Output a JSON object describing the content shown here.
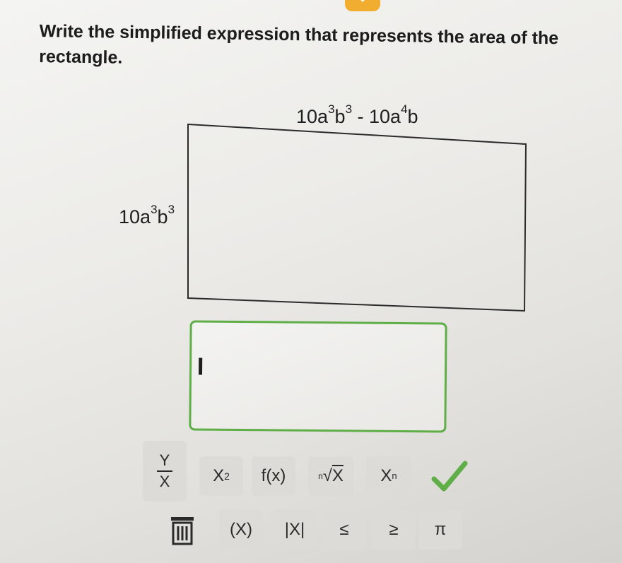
{
  "question": {
    "line1": "Write the simplified expression that represents the area of the",
    "line2": "rectangle."
  },
  "diagram": {
    "top_label": {
      "c": "10a",
      "e1": "3",
      "b1": "b",
      "e2": "3",
      "op": " - 10a",
      "e3": "4",
      "b2": "b"
    },
    "left_label": {
      "c": "10a",
      "e1": "3",
      "b1": "b",
      "e2": "3"
    }
  },
  "answer": {
    "value": ""
  },
  "keypad": {
    "fraction": {
      "numerator": "Y",
      "denominator": "X"
    },
    "power": {
      "base": "X",
      "exponent": "2"
    },
    "function": "f(x)",
    "root": {
      "index": "n",
      "radicand": "X"
    },
    "subscript": {
      "base": "X",
      "sub": "n"
    },
    "parentheses": "(X)",
    "absolute": "|X|",
    "less_equal": "≤",
    "greater_equal": "≥",
    "pi": "π"
  },
  "colors": {
    "accent_green": "#5fae47",
    "key_background": "#dcdbd7",
    "tab_orange": "#f0ad2f"
  },
  "icons": [
    "trash-icon",
    "checkmark-icon"
  ]
}
